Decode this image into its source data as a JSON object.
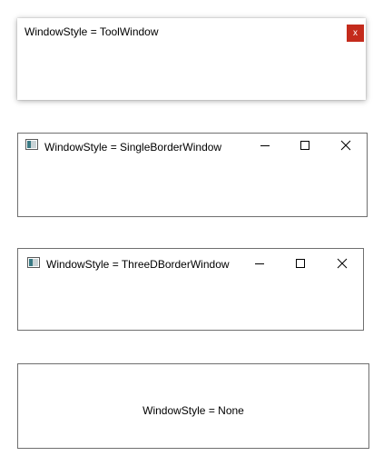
{
  "windows": [
    {
      "title": "WindowStyle = ToolWindow",
      "close_glyph": "x"
    },
    {
      "title": "WindowStyle = SingleBorderWindow"
    },
    {
      "title": "WindowStyle = ThreeDBorderWindow"
    },
    {
      "title": "WindowStyle = None"
    }
  ],
  "icons": {
    "app": "app-icon",
    "minimize": "minimize-icon",
    "maximize": "maximize-icon",
    "close": "close-icon"
  },
  "colors": {
    "close_red": "#c42b1c",
    "border": "#6f6f6f",
    "icon_teal": "#3a7a84"
  }
}
